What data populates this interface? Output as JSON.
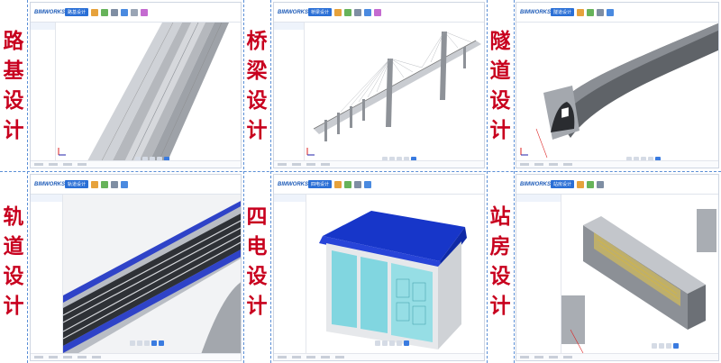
{
  "brand": "BIMWORKS",
  "categories": [
    {
      "id": "road",
      "label": [
        "路",
        "基",
        "设",
        "计"
      ],
      "tab": "路基设计"
    },
    {
      "id": "bridge",
      "label": [
        "桥",
        "梁",
        "设",
        "计"
      ],
      "tab": "桥梁设计"
    },
    {
      "id": "tunnel",
      "label": [
        "隧",
        "道",
        "设",
        "计"
      ],
      "tab": "隧道设计"
    },
    {
      "id": "track",
      "label": [
        "轨",
        "道",
        "设",
        "计"
      ],
      "tab": "轨道设计"
    },
    {
      "id": "electric",
      "label": [
        "四",
        "电",
        "设",
        "计"
      ],
      "tab": "四电设计"
    },
    {
      "id": "station",
      "label": [
        "站",
        "房",
        "设",
        "计"
      ],
      "tab": "站房设计"
    }
  ],
  "colors": {
    "label_red": "#c8001e",
    "divider_blue": "#5b8fd6",
    "accent_blue": "#2a6fd6",
    "roof_blue": "#1736c9",
    "glass_cyan": "#5fd0dc"
  },
  "icons": [
    "axis-gizmo-icon",
    "view-control-icon",
    "toolbar-tool-icon"
  ]
}
